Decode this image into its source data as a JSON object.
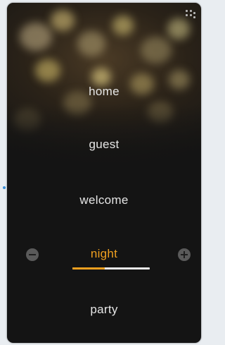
{
  "scenes": [
    {
      "label": "home",
      "active": false
    },
    {
      "label": "guest",
      "active": false
    },
    {
      "label": "welcome",
      "active": false
    },
    {
      "label": "night",
      "active": true
    },
    {
      "label": "party",
      "active": false
    }
  ],
  "active_scene": {
    "label": "night",
    "level_fraction": 0.42
  },
  "controls": {
    "decrease_icon": "minus-circle-icon",
    "increase_icon": "plus-circle-icon",
    "menu_icon": "grid-dots-icon"
  },
  "colors": {
    "accent": "#f0a020",
    "text": "#e6e6e6",
    "panel": "#141414",
    "button": "#5a5a5a",
    "indicator": "#3b8fd6"
  }
}
